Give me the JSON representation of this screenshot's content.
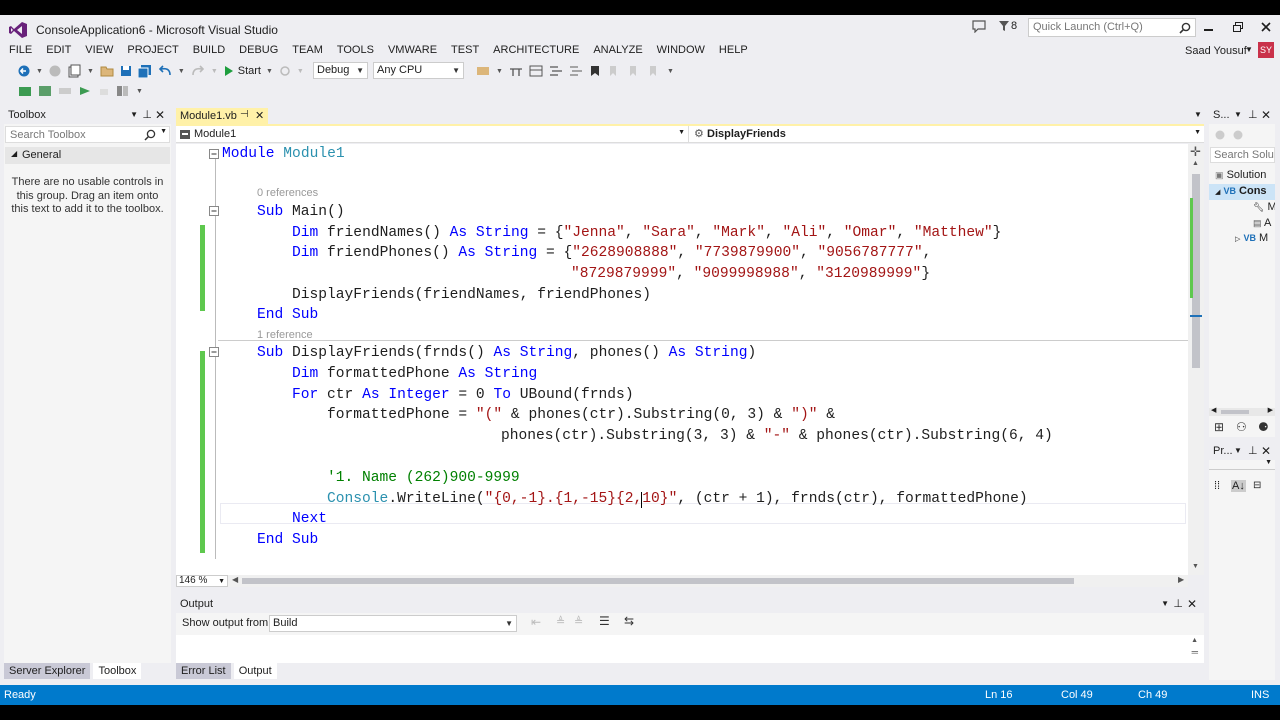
{
  "window": {
    "title": "ConsoleApplication6 - Microsoft Visual Studio",
    "quick_launch_placeholder": "Quick Launch (Ctrl+Q)",
    "notif_count": "8",
    "user_name": "Saad Yousuf",
    "user_initials": "SY"
  },
  "menu": [
    "FILE",
    "EDIT",
    "VIEW",
    "PROJECT",
    "BUILD",
    "DEBUG",
    "TEAM",
    "TOOLS",
    "VMWARE",
    "TEST",
    "ARCHITECTURE",
    "ANALYZE",
    "WINDOW",
    "HELP"
  ],
  "toolbar": {
    "start_label": "Start",
    "config": "Debug",
    "platform": "Any CPU"
  },
  "toolbox": {
    "title": "Toolbox",
    "search_placeholder": "Search Toolbox",
    "group": "General",
    "empty_msg_1": "There are no usable controls in",
    "empty_msg_2": "this group. Drag an item onto",
    "empty_msg_3": "this text to add it to the toolbox."
  },
  "left_tabs": [
    "Server Explorer",
    "Toolbox"
  ],
  "editor": {
    "tab": "Module1.vb",
    "nav_left": "Module1",
    "nav_right": "DisplayFriends",
    "zoom": "146 %",
    "refs_1": "0 references",
    "refs_2": "1 reference",
    "lines": {
      "l1_kw": "Module",
      "l1_name": " Module1",
      "l2_kw": "Sub",
      "l2_rest": " Main()",
      "l3_kw1": "Dim",
      "l3_a": " friendNames() ",
      "l3_kw2": "As",
      "l3_ty": " String",
      "l3_b": " = {",
      "l3_s1": "\"Jenna\"",
      "l3_s2": "\"Sara\"",
      "l3_s3": "\"Mark\"",
      "l3_s4": "\"Ali\"",
      "l3_s5": "\"Omar\"",
      "l3_s6": "\"Matthew\"",
      "l3_end": "}",
      "l4_kw1": "Dim",
      "l4_a": " friendPhones() ",
      "l4_kw2": "As",
      "l4_ty": " String",
      "l4_b": " = {",
      "l4_s1": "\"2628908888\"",
      "l4_s2": "\"7739879900\"",
      "l4_s3": "\"9056787777\"",
      "l4_c": ",",
      "l5_s1": "\"8729879999\"",
      "l5_s2": "\"9099998988\"",
      "l5_s3": "\"3120989999\"",
      "l5_end": "}",
      "l6": "DisplayFriends(friendNames, friendPhones)",
      "l7_kw1": "End",
      "l7_kw2": "Sub",
      "l8_kw": "Sub",
      "l8_a": " DisplayFriends(frnds() ",
      "l8_kw2": "As",
      "l8_ty": " String",
      "l8_b": ", phones() ",
      "l8_kw3": "As",
      "l8_ty2": " String",
      "l8_c": ")",
      "l9_kw": "Dim",
      "l9_a": " formattedPhone ",
      "l9_kw2": "As",
      "l9_ty": " String",
      "l10_kw": "For",
      "l10_a": " ctr ",
      "l10_kw2": "As",
      "l10_ty": " Integer",
      "l10_b": " = 0 ",
      "l10_kw3": "To",
      "l10_c": " UBound(frnds)",
      "l11_a": "formattedPhone = ",
      "l11_s1": "\"(\"",
      "l11_b": " & phones(ctr).Substring(0, 3) & ",
      "l11_s2": "\")\"",
      "l11_c": " &",
      "l12_a": "phones(ctr).Substring(3, 3) & ",
      "l12_s1": "\"-\"",
      "l12_b": " & phones(ctr).Substring(6, 4)",
      "l13_cm": "'1. Name (262)900-9999",
      "l14_ty": "Console",
      "l14_a": ".WriteLine(",
      "l14_s1": "\"{0,-1}.{1,-15}{2,10}\"",
      "l14_b": ", (ctr + 1), frnds(ctr), formattedPhone)",
      "l15_kw": "Next",
      "l16_kw1": "End",
      "l16_kw2": "Sub"
    }
  },
  "solution": {
    "title": "S...",
    "search": "Search Solu",
    "items": [
      "Solution",
      "Cons",
      "M",
      "A",
      "M"
    ]
  },
  "properties": {
    "title": "Pr..."
  },
  "output": {
    "title": "Output",
    "show_from_label": "Show output from:",
    "source": "Build"
  },
  "bottom_tabs": [
    "Error List",
    "Output"
  ],
  "status": {
    "ready": "Ready",
    "ln": "Ln 16",
    "col": "Col 49",
    "ch": "Ch 49",
    "ins": "INS"
  },
  "colors": {
    "accent": "#007acc",
    "keyword": "#0000ff",
    "type": "#2b91af",
    "string": "#a31515",
    "comment": "#008000",
    "vs_purple": "#68217a"
  }
}
